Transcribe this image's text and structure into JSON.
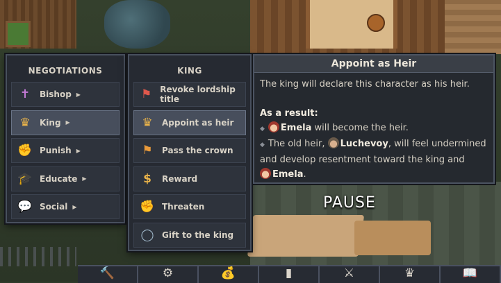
{
  "negotiations": {
    "title": "NEGOTIATIONS",
    "items": [
      {
        "label": "Bishop",
        "icon": "cross-icon",
        "glyph": "✝",
        "color": "#c47ad6",
        "submenu": true
      },
      {
        "label": "King",
        "icon": "crown-icon",
        "glyph": "♛",
        "color": "#e9b34a",
        "submenu": true,
        "selected": true
      },
      {
        "label": "Punish",
        "icon": "punch-icon",
        "glyph": "✊",
        "color": "#e7e2da",
        "submenu": true
      },
      {
        "label": "Educate",
        "icon": "graduation-cap-icon",
        "glyph": "🎓",
        "color": "#9aa4b2",
        "submenu": true
      },
      {
        "label": "Social",
        "icon": "speech-bubble-icon",
        "glyph": "💬",
        "color": "#e9b34a",
        "submenu": true
      }
    ]
  },
  "king": {
    "title": "KING",
    "items": [
      {
        "label": "Revoke lordship title",
        "icon": "revoke-banner-icon",
        "glyph": "⚑",
        "color": "#e0584c"
      },
      {
        "label": "Appoint as heir",
        "icon": "crown-icon",
        "glyph": "♛",
        "color": "#e9b34a",
        "selected": true
      },
      {
        "label": "Pass the crown",
        "icon": "crown-banner-icon",
        "glyph": "⚑",
        "color": "#e99a3a"
      },
      {
        "label": "Reward",
        "icon": "money-bag-icon",
        "glyph": "$",
        "color": "#e9b34a"
      },
      {
        "label": "Threaten",
        "icon": "fist-icon",
        "glyph": "✊",
        "color": "#f0b040"
      },
      {
        "label": "Gift to the king",
        "icon": "ring-icon",
        "glyph": "◯",
        "color": "#9fb6c8"
      }
    ]
  },
  "tooltip": {
    "title": "Appoint as Heir",
    "description": "The king will declare this character as his heir.",
    "result_heading": "As a result:",
    "line1_name": "Emela",
    "line1_text": " will become the heir.",
    "line2_pre": "The old heir, ",
    "line2_name": "Luchevoy",
    "line2_post": ", will feel undermined",
    "line3": "and develop resentment toward the king and",
    "line4_name": "Emela",
    "line4_post": "."
  },
  "status": {
    "pause": "PAUSE"
  },
  "hud": [
    {
      "icon": "hammer-icon",
      "glyph": "🔨"
    },
    {
      "icon": "gear-icon",
      "glyph": "⚙"
    },
    {
      "icon": "money-bag-icon",
      "glyph": "💰"
    },
    {
      "icon": "bar-chart-icon",
      "glyph": "▮"
    },
    {
      "icon": "crossed-swords-icon",
      "glyph": "⚔"
    },
    {
      "icon": "crown-icon",
      "glyph": "♛"
    },
    {
      "icon": "book-icon",
      "glyph": "📖"
    }
  ]
}
